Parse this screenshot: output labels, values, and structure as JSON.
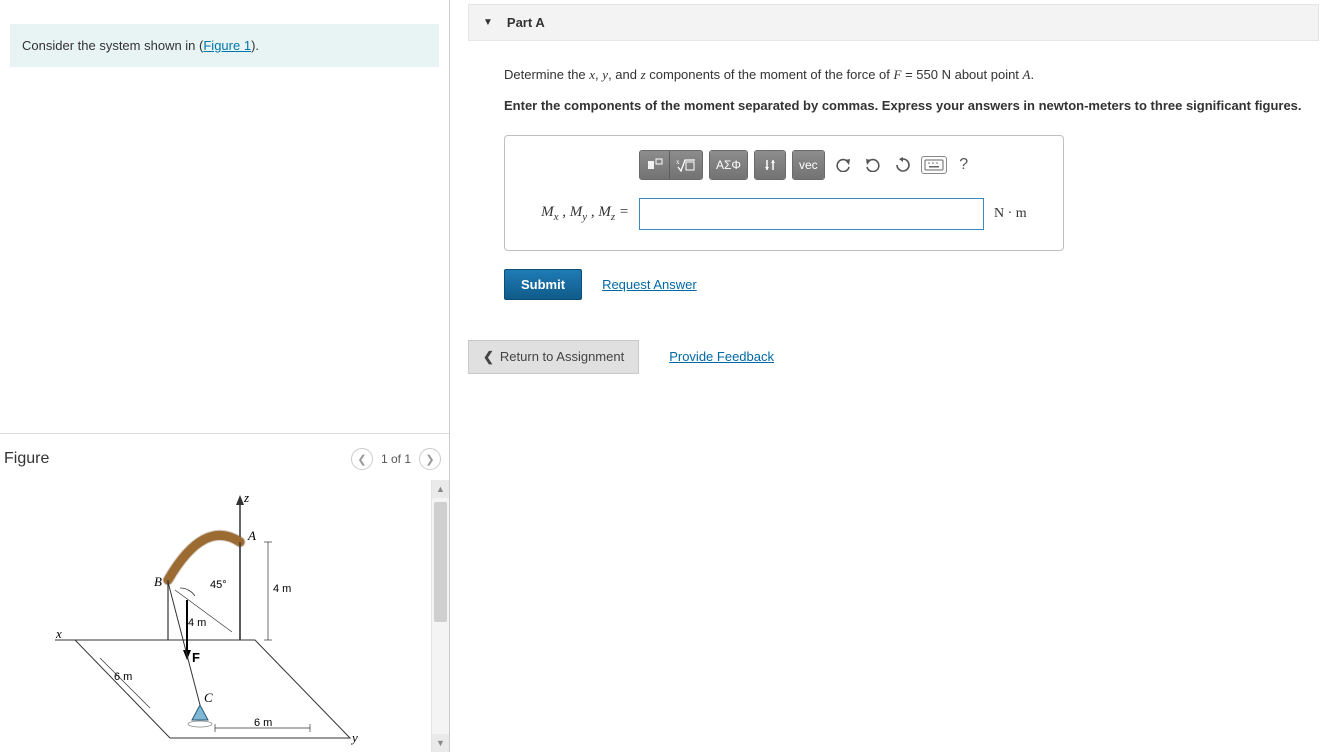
{
  "intro": {
    "prefix": "Consider the system shown in (",
    "link": "Figure 1",
    "suffix": ")."
  },
  "figure": {
    "title": "Figure",
    "pager_text": "1 of 1",
    "labels": {
      "z": "z",
      "y": "y",
      "x": "x",
      "A": "A",
      "B": "B",
      "C": "C",
      "F": "F",
      "angle": "45°",
      "dim_4m_v": "4 m",
      "dim_4m_d": "4 m",
      "dim_6m_x": "6 m",
      "dim_6m_y": "6 m"
    }
  },
  "part": {
    "header": "Part A",
    "prompt_html": "Determine the <span class='math-ital'>x</span>, <span class='math-ital'>y</span>, and <span class='math-ital'>z</span> components of the moment of the force of <span class='math-ital'>F</span> = 550 N about point <span class='math-ital'>A</span>.",
    "instruction": "Enter the components of the moment separated by commas. Express your answers in newton-meters to three significant figures.",
    "toolbar": {
      "templates_title": "templates",
      "sqrt_title": "radical",
      "greek": "ΑΣΦ",
      "subscript_title": "sub/sup",
      "vec": "vec",
      "undo_title": "undo",
      "redo_title": "redo",
      "reset_title": "reset",
      "keyboard_title": "keyboard",
      "help": "?"
    },
    "entry_label_html": "M<sub>x</sub> , M<sub>y</sub> , M<sub>z</sub> =",
    "entry_value": "",
    "units": "N · m",
    "submit": "Submit",
    "request_answer": "Request Answer"
  },
  "footer": {
    "return": "Return to Assignment",
    "feedback": "Provide Feedback"
  }
}
